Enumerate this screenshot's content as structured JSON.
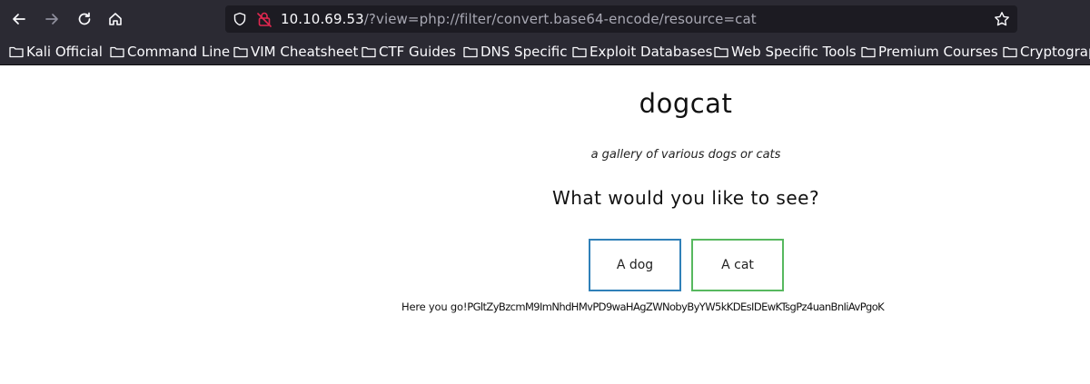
{
  "browser": {
    "url_host": "10.10.69.53",
    "url_path": "/?view=php://filter/convert.base64-encode/resource=cat",
    "nav_icons": [
      "back-arrow-icon",
      "forward-arrow-icon",
      "reload-icon",
      "home-icon"
    ],
    "bookmarks": [
      {
        "label": "Kali Official"
      },
      {
        "label": "Command Line"
      },
      {
        "label": "VIM Cheatsheet"
      },
      {
        "label": "CTF Guides"
      },
      {
        "label": "DNS Specific"
      },
      {
        "label": "Exploit Databases"
      },
      {
        "label": "Web Specific Tools"
      },
      {
        "label": "Premium Courses"
      },
      {
        "label": "Cryptograp"
      }
    ]
  },
  "page": {
    "title": "dogcat",
    "subtitle": "a gallery of various dogs or cats",
    "question": "What would you like to see?",
    "buttons": {
      "dog": "A dog",
      "cat": "A cat"
    },
    "output_prefix": "Here you go!",
    "output_payload": "PGltZyBzcmM9ImNhdHMvPD9waHAgZWNobyByYW5kKDEsIDEwKTsgPz4uanBnIiAvPgoK"
  },
  "colors": {
    "toolbar_bg": "#2b2a33",
    "urlbar_bg": "#1c1b22",
    "dog_border": "#2f80b8",
    "cat_border": "#57b85f",
    "lock_red": "#e22850"
  }
}
